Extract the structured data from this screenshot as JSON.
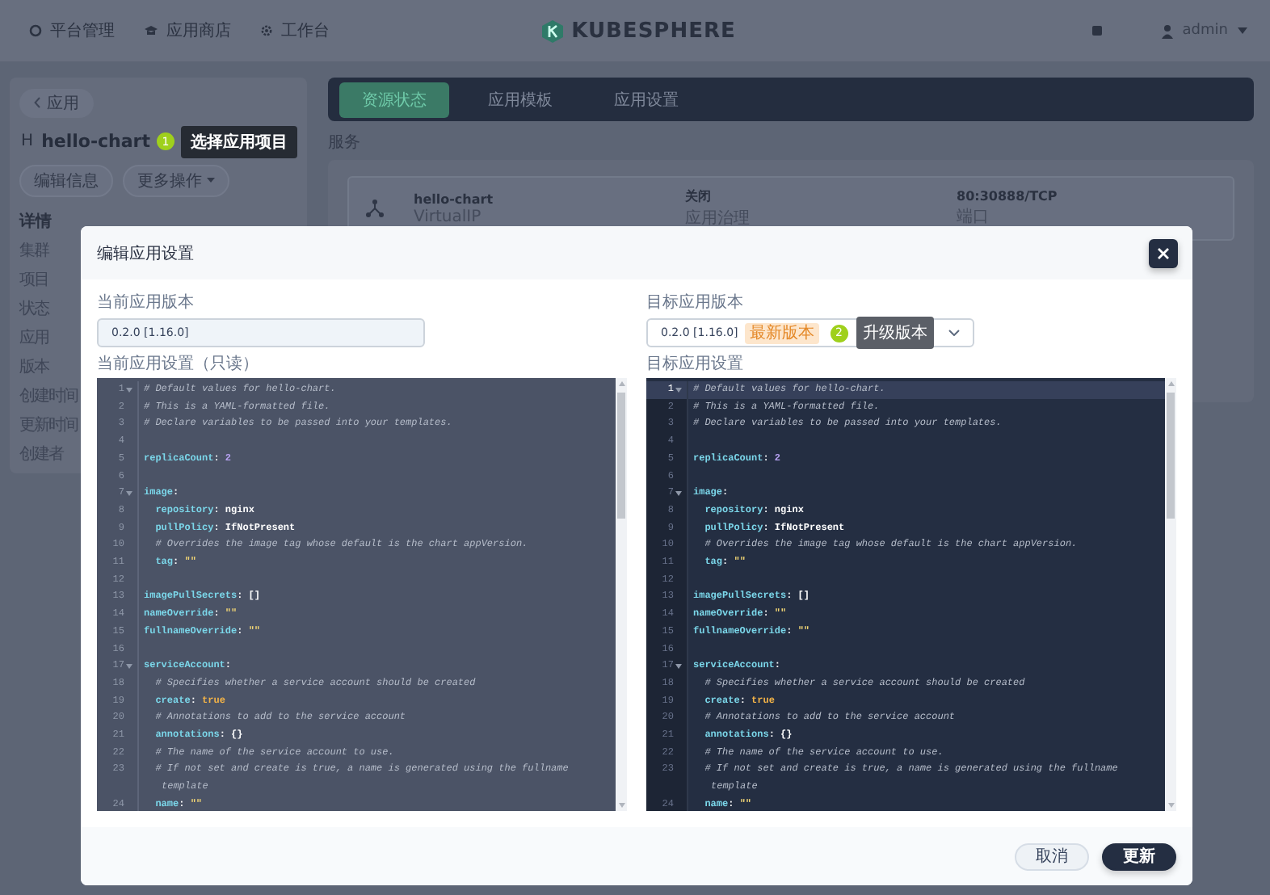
{
  "top_nav": {
    "items": [
      {
        "label": "平台管理",
        "kind": "platform"
      },
      {
        "label": "应用商店",
        "kind": "store"
      },
      {
        "label": "工作台",
        "kind": "workbench"
      }
    ],
    "logo_text": "KUBESPHERE",
    "user": "admin"
  },
  "app": {
    "back_label": "应用",
    "avatar": "H",
    "name": "hello-chart",
    "step_badge": "1",
    "step_tip": "选择应用项目",
    "buttons": [
      {
        "label": "编辑信息",
        "caret": false
      },
      {
        "label": "更多操作",
        "caret": true
      }
    ],
    "details_title": "详情",
    "detail_labels": [
      "集群",
      "项目",
      "状态",
      "应用",
      "版本",
      "创建时间",
      "更新时间",
      "创建者"
    ]
  },
  "tabs": [
    {
      "label": "资源状态",
      "selected": true
    },
    {
      "label": "应用模板",
      "selected": false
    },
    {
      "label": "应用设置",
      "selected": false
    }
  ],
  "services": {
    "title": "服务",
    "card": {
      "name": "hello-chart",
      "type": "VirtualIP",
      "mode": "关闭",
      "mode_label": "应用治理",
      "port": "80:30888/TCP",
      "port_label": "端口"
    }
  },
  "dialog": {
    "title": "编辑应用设置",
    "current_version": {
      "label": "当前应用版本",
      "kind": "readonly",
      "value": "0.2.0 [1.16.0]"
    },
    "current_settings": {
      "label": "当前应用设置（只读）",
      "read_only": true,
      "lines": [
        {
          "number": "1",
          "fold": true,
          "active": false,
          "segments": [
            {
              "kind": "comment",
              "text": "# Default values for hello-chart."
            }
          ]
        },
        {
          "number": "2",
          "fold": false,
          "active": false,
          "segments": [
            {
              "kind": "comment",
              "text": "# This is a YAML-formatted file."
            }
          ]
        },
        {
          "number": "3",
          "fold": false,
          "active": false,
          "segments": [
            {
              "kind": "comment",
              "text": "# Declare variables to be passed into your templates."
            }
          ]
        },
        {
          "number": "4",
          "fold": false,
          "active": false
        },
        {
          "number": "5",
          "fold": false,
          "active": false,
          "segments": [
            {
              "kind": "key",
              "text": "replicaCount"
            },
            {
              "kind": "plain",
              "text": ": "
            },
            {
              "kind": "number",
              "text": "2"
            }
          ]
        },
        {
          "number": "6",
          "fold": false,
          "active": false
        },
        {
          "number": "7",
          "fold": true,
          "active": false,
          "segments": [
            {
              "kind": "key",
              "text": "image"
            },
            {
              "kind": "plain",
              "text": ":"
            }
          ]
        },
        {
          "number": "8",
          "fold": false,
          "active": false,
          "segments": [
            {
              "kind": "key",
              "text": "  repository"
            },
            {
              "kind": "plain",
              "text": ": nginx"
            }
          ]
        },
        {
          "number": "9",
          "fold": false,
          "active": false,
          "segments": [
            {
              "kind": "key",
              "text": "  pullPolicy"
            },
            {
              "kind": "plain",
              "text": ": IfNotPresent"
            }
          ]
        },
        {
          "number": "10",
          "fold": false,
          "active": false,
          "segments": [
            {
              "kind": "comment",
              "text": "  # Overrides the image tag whose default is the chart appVersion."
            }
          ]
        },
        {
          "number": "11",
          "fold": false,
          "active": false,
          "segments": [
            {
              "kind": "key",
              "text": "  tag"
            },
            {
              "kind": "plain",
              "text": ": "
            },
            {
              "kind": "string",
              "text": "\"\""
            }
          ]
        },
        {
          "number": "12",
          "fold": false,
          "active": false
        },
        {
          "number": "13",
          "fold": false,
          "active": false,
          "segments": [
            {
              "kind": "key",
              "text": "imagePullSecrets"
            },
            {
              "kind": "plain",
              "text": ": []"
            }
          ]
        },
        {
          "number": "14",
          "fold": false,
          "active": false,
          "segments": [
            {
              "kind": "key",
              "text": "nameOverride"
            },
            {
              "kind": "plain",
              "text": ": "
            },
            {
              "kind": "string",
              "text": "\"\""
            }
          ]
        },
        {
          "number": "15",
          "fold": false,
          "active": false,
          "segments": [
            {
              "kind": "key",
              "text": "fullnameOverride"
            },
            {
              "kind": "plain",
              "text": ": "
            },
            {
              "kind": "string",
              "text": "\"\""
            }
          ]
        },
        {
          "number": "16",
          "fold": false,
          "active": false
        },
        {
          "number": "17",
          "fold": true,
          "active": false,
          "segments": [
            {
              "kind": "key",
              "text": "serviceAccount"
            },
            {
              "kind": "plain",
              "text": ":"
            }
          ]
        },
        {
          "number": "18",
          "fold": false,
          "active": false,
          "segments": [
            {
              "kind": "comment",
              "text": "  # Specifies whether a service account should be created"
            }
          ]
        },
        {
          "number": "19",
          "fold": false,
          "active": false,
          "segments": [
            {
              "kind": "key",
              "text": "  create"
            },
            {
              "kind": "plain",
              "text": ": "
            },
            {
              "kind": "bool",
              "text": "true"
            }
          ]
        },
        {
          "number": "20",
          "fold": false,
          "active": false,
          "segments": [
            {
              "kind": "comment",
              "text": "  # Annotations to add to the service account"
            }
          ]
        },
        {
          "number": "21",
          "fold": false,
          "active": false,
          "segments": [
            {
              "kind": "key",
              "text": "  annotations"
            },
            {
              "kind": "plain",
              "text": ": {}"
            }
          ]
        },
        {
          "number": "22",
          "fold": false,
          "active": false,
          "segments": [
            {
              "kind": "comment",
              "text": "  # The name of the service account to use."
            }
          ]
        },
        {
          "number": "23",
          "fold": false,
          "active": false,
          "segments": [
            {
              "kind": "comment",
              "text": "  # If not set and create is true, a name is generated using the fullname template"
            }
          ]
        },
        {
          "number": "24",
          "fold": false,
          "active": false,
          "segments": [
            {
              "kind": "key",
              "text": "  name"
            },
            {
              "kind": "plain",
              "text": ": "
            },
            {
              "kind": "string",
              "text": "\"\""
            }
          ]
        }
      ]
    },
    "target_version": {
      "label": "目标应用版本",
      "kind": "select",
      "value": "0.2.0 [1.16.0]",
      "tag": "最新版本",
      "step_badge": "2",
      "step_tip": "升级版本"
    },
    "target_settings": {
      "label": "目标应用设置",
      "read_only": false,
      "lines": [
        {
          "number": "1",
          "fold": true,
          "active": true,
          "segments": [
            {
              "kind": "comment",
              "text": "# Default values for hello-chart."
            }
          ]
        },
        {
          "number": "2",
          "fold": false,
          "active": false,
          "segments": [
            {
              "kind": "comment",
              "text": "# This is a YAML-formatted file."
            }
          ]
        },
        {
          "number": "3",
          "fold": false,
          "active": false,
          "segments": [
            {
              "kind": "comment",
              "text": "# Declare variables to be passed into your templates."
            }
          ]
        },
        {
          "number": "4",
          "fold": false,
          "active": false
        },
        {
          "number": "5",
          "fold": false,
          "active": false,
          "segments": [
            {
              "kind": "key",
              "text": "replicaCount"
            },
            {
              "kind": "plain",
              "text": ": "
            },
            {
              "kind": "number",
              "text": "2"
            }
          ]
        },
        {
          "number": "6",
          "fold": false,
          "active": false
        },
        {
          "number": "7",
          "fold": true,
          "active": false,
          "segments": [
            {
              "kind": "key",
              "text": "image"
            },
            {
              "kind": "plain",
              "text": ":"
            }
          ]
        },
        {
          "number": "8",
          "fold": false,
          "active": false,
          "segments": [
            {
              "kind": "key",
              "text": "  repository"
            },
            {
              "kind": "plain",
              "text": ": nginx"
            }
          ]
        },
        {
          "number": "9",
          "fold": false,
          "active": false,
          "segments": [
            {
              "kind": "key",
              "text": "  pullPolicy"
            },
            {
              "kind": "plain",
              "text": ": IfNotPresent"
            }
          ]
        },
        {
          "number": "10",
          "fold": false,
          "active": false,
          "segments": [
            {
              "kind": "comment",
              "text": "  # Overrides the image tag whose default is the chart appVersion."
            }
          ]
        },
        {
          "number": "11",
          "fold": false,
          "active": false,
          "segments": [
            {
              "kind": "key",
              "text": "  tag"
            },
            {
              "kind": "plain",
              "text": ": "
            },
            {
              "kind": "string",
              "text": "\"\""
            }
          ]
        },
        {
          "number": "12",
          "fold": false,
          "active": false
        },
        {
          "number": "13",
          "fold": false,
          "active": false,
          "segments": [
            {
              "kind": "key",
              "text": "imagePullSecrets"
            },
            {
              "kind": "plain",
              "text": ": []"
            }
          ]
        },
        {
          "number": "14",
          "fold": false,
          "active": false,
          "segments": [
            {
              "kind": "key",
              "text": "nameOverride"
            },
            {
              "kind": "plain",
              "text": ": "
            },
            {
              "kind": "string",
              "text": "\"\""
            }
          ]
        },
        {
          "number": "15",
          "fold": false,
          "active": false,
          "segments": [
            {
              "kind": "key",
              "text": "fullnameOverride"
            },
            {
              "kind": "plain",
              "text": ": "
            },
            {
              "kind": "string",
              "text": "\"\""
            }
          ]
        },
        {
          "number": "16",
          "fold": false,
          "active": false
        },
        {
          "number": "17",
          "fold": true,
          "active": false,
          "segments": [
            {
              "kind": "key",
              "text": "serviceAccount"
            },
            {
              "kind": "plain",
              "text": ":"
            }
          ]
        },
        {
          "number": "18",
          "fold": false,
          "active": false,
          "segments": [
            {
              "kind": "comment",
              "text": "  # Specifies whether a service account should be created"
            }
          ]
        },
        {
          "number": "19",
          "fold": false,
          "active": false,
          "segments": [
            {
              "kind": "key",
              "text": "  create"
            },
            {
              "kind": "plain",
              "text": ": "
            },
            {
              "kind": "bool",
              "text": "true"
            }
          ]
        },
        {
          "number": "20",
          "fold": false,
          "active": false,
          "segments": [
            {
              "kind": "comment",
              "text": "  # Annotations to add to the service account"
            }
          ]
        },
        {
          "number": "21",
          "fold": false,
          "active": false,
          "segments": [
            {
              "kind": "key",
              "text": "  annotations"
            },
            {
              "kind": "plain",
              "text": ": {}"
            }
          ]
        },
        {
          "number": "22",
          "fold": false,
          "active": false,
          "segments": [
            {
              "kind": "comment",
              "text": "  # The name of the service account to use."
            }
          ]
        },
        {
          "number": "23",
          "fold": false,
          "active": false,
          "segments": [
            {
              "kind": "comment",
              "text": "  # If not set and create is true, a name is generated using the fullname template"
            }
          ]
        },
        {
          "number": "24",
          "fold": false,
          "active": false,
          "segments": [
            {
              "kind": "key",
              "text": "  name"
            },
            {
              "kind": "plain",
              "text": ": "
            },
            {
              "kind": "string",
              "text": "\"\""
            }
          ]
        }
      ]
    },
    "buttons": [
      {
        "label": "取消",
        "kind": "secondary"
      },
      {
        "label": "更新",
        "kind": "primary"
      }
    ]
  }
}
